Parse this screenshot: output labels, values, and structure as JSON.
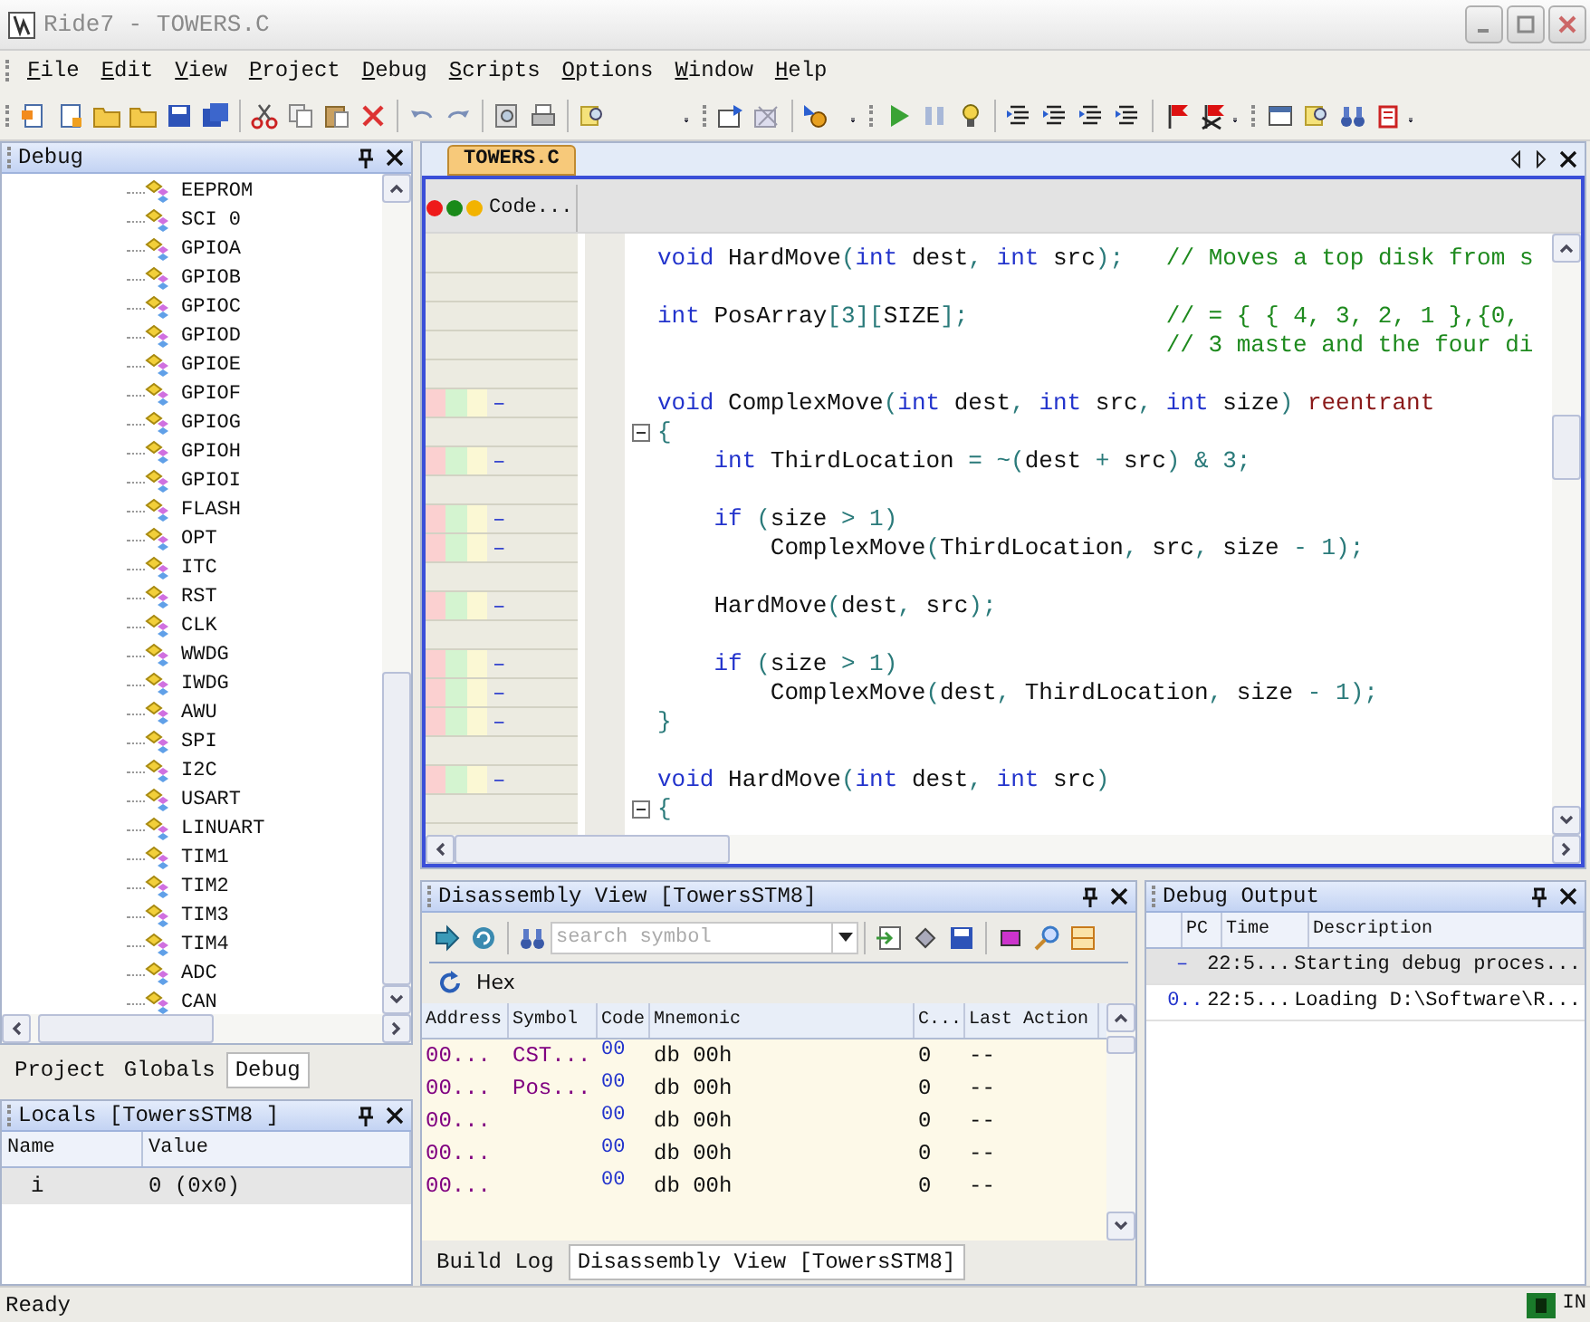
{
  "window": {
    "title": "Ride7 - TOWERS.C"
  },
  "menu": [
    "File",
    "Edit",
    "View",
    "Project",
    "Debug",
    "Scripts",
    "Options",
    "Window",
    "Help"
  ],
  "debug_panel": {
    "title": "Debug",
    "items": [
      "EEPROM",
      "SCI 0",
      "GPIOA",
      "GPIOB",
      "GPIOC",
      "GPIOD",
      "GPIOE",
      "GPIOF",
      "GPIOG",
      "GPIOH",
      "GPIOI",
      "FLASH",
      "OPT",
      "ITC",
      "RST",
      "CLK",
      "WWDG",
      "IWDG",
      "AWU",
      "SPI",
      "I2C",
      "USART",
      "LINUART",
      "TIM1",
      "TIM2",
      "TIM3",
      "TIM4",
      "ADC",
      "CAN"
    ]
  },
  "left_tabs": [
    {
      "label": "Project",
      "selected": false
    },
    {
      "label": "Globals",
      "selected": false
    },
    {
      "label": "Debug",
      "selected": true
    }
  ],
  "locals": {
    "title": "Locals [TowersSTM8 ]",
    "columns": [
      "Name",
      "Value"
    ],
    "rows": [
      [
        "i",
        "0 (0x0)"
      ]
    ]
  },
  "editor": {
    "tab": {
      "label": "TOWERS.C",
      "selected": true
    },
    "gutter_title": "Code...",
    "lines": [
      {
        "marked": false,
        "fold": false,
        "segments": [
          {
            "kind": "kw",
            "t": "void"
          },
          {
            "kind": "id",
            "t": " HardMove"
          },
          {
            "kind": "p",
            "t": "("
          },
          {
            "kind": "kw",
            "t": "int"
          },
          {
            "kind": "id",
            "t": " dest"
          },
          {
            "kind": "p",
            "t": ", "
          },
          {
            "kind": "kw",
            "t": "int"
          },
          {
            "kind": "id",
            "t": " src"
          },
          {
            "kind": "p",
            "t": ");"
          },
          {
            "kind": "c",
            "t": "   // Moves a top disk from s"
          }
        ]
      },
      {
        "marked": false,
        "fold": false
      },
      {
        "marked": false,
        "fold": false,
        "segments": [
          {
            "kind": "kw",
            "t": "int"
          },
          {
            "kind": "id",
            "t": " PosArray"
          },
          {
            "kind": "p",
            "t": "["
          },
          {
            "kind": "n",
            "t": "3"
          },
          {
            "kind": "p",
            "t": "]["
          },
          {
            "kind": "id",
            "t": "SIZE"
          },
          {
            "kind": "p",
            "t": "];"
          },
          {
            "kind": "c",
            "t": "              // = { { 4, 3, 2, 1 },{0,"
          }
        ]
      },
      {
        "marked": false,
        "fold": false,
        "segments": [
          {
            "kind": "c",
            "t": "                                    // 3 maste and the four di"
          }
        ]
      },
      {
        "marked": false,
        "fold": false
      },
      {
        "marked": true,
        "fold": false,
        "gutter": "–",
        "segments": [
          {
            "kind": "kw",
            "t": "void"
          },
          {
            "kind": "id",
            "t": " ComplexMove"
          },
          {
            "kind": "p",
            "t": "("
          },
          {
            "kind": "kw",
            "t": "int"
          },
          {
            "kind": "id",
            "t": " dest"
          },
          {
            "kind": "p",
            "t": ", "
          },
          {
            "kind": "kw",
            "t": "int"
          },
          {
            "kind": "id",
            "t": " src"
          },
          {
            "kind": "p",
            "t": ", "
          },
          {
            "kind": "kw",
            "t": "int"
          },
          {
            "kind": "id",
            "t": " size"
          },
          {
            "kind": "p",
            "t": ") "
          },
          {
            "kind": "r",
            "t": "reentrant"
          }
        ]
      },
      {
        "marked": false,
        "fold": true,
        "segments": [
          {
            "kind": "p",
            "t": "{"
          }
        ]
      },
      {
        "marked": true,
        "fold": false,
        "gutter": "–",
        "segments": [
          {
            "kind": "kw",
            "t": "    int"
          },
          {
            "kind": "id",
            "t": " ThirdLocation "
          },
          {
            "kind": "p",
            "t": "= ~("
          },
          {
            "kind": "id",
            "t": "dest "
          },
          {
            "kind": "p",
            "t": "+ "
          },
          {
            "kind": "id",
            "t": "src"
          },
          {
            "kind": "p",
            "t": ") & "
          },
          {
            "kind": "n",
            "t": "3"
          },
          {
            "kind": "p",
            "t": ";"
          }
        ]
      },
      {
        "marked": false,
        "fold": false
      },
      {
        "marked": true,
        "fold": false,
        "gutter": "–",
        "segments": [
          {
            "kind": "kw",
            "t": "    if"
          },
          {
            "kind": "p",
            "t": " ("
          },
          {
            "kind": "id",
            "t": "size "
          },
          {
            "kind": "p",
            "t": "> "
          },
          {
            "kind": "n",
            "t": "1"
          },
          {
            "kind": "p",
            "t": ")"
          }
        ]
      },
      {
        "marked": true,
        "fold": false,
        "gutter": "–",
        "segments": [
          {
            "kind": "id",
            "t": "        ComplexMove"
          },
          {
            "kind": "p",
            "t": "("
          },
          {
            "kind": "id",
            "t": "ThirdLocation"
          },
          {
            "kind": "p",
            "t": ", "
          },
          {
            "kind": "id",
            "t": "src"
          },
          {
            "kind": "p",
            "t": ", "
          },
          {
            "kind": "id",
            "t": "size "
          },
          {
            "kind": "p",
            "t": "- "
          },
          {
            "kind": "n",
            "t": "1"
          },
          {
            "kind": "p",
            "t": ");"
          }
        ]
      },
      {
        "marked": false,
        "fold": false
      },
      {
        "marked": true,
        "fold": false,
        "gutter": "–",
        "segments": [
          {
            "kind": "id",
            "t": "    HardMove"
          },
          {
            "kind": "p",
            "t": "("
          },
          {
            "kind": "id",
            "t": "dest"
          },
          {
            "kind": "p",
            "t": ", "
          },
          {
            "kind": "id",
            "t": "src"
          },
          {
            "kind": "p",
            "t": ");"
          }
        ]
      },
      {
        "marked": false,
        "fold": false
      },
      {
        "marked": true,
        "fold": false,
        "gutter": "–",
        "segments": [
          {
            "kind": "kw",
            "t": "    if"
          },
          {
            "kind": "p",
            "t": " ("
          },
          {
            "kind": "id",
            "t": "size "
          },
          {
            "kind": "p",
            "t": "> "
          },
          {
            "kind": "n",
            "t": "1"
          },
          {
            "kind": "p",
            "t": ")"
          }
        ]
      },
      {
        "marked": true,
        "fold": false,
        "gutter": "–",
        "segments": [
          {
            "kind": "id",
            "t": "        ComplexMove"
          },
          {
            "kind": "p",
            "t": "("
          },
          {
            "kind": "id",
            "t": "dest"
          },
          {
            "kind": "p",
            "t": ", "
          },
          {
            "kind": "id",
            "t": "ThirdLocation"
          },
          {
            "kind": "p",
            "t": ", "
          },
          {
            "kind": "id",
            "t": "size "
          },
          {
            "kind": "p",
            "t": "- "
          },
          {
            "kind": "n",
            "t": "1"
          },
          {
            "kind": "p",
            "t": ");"
          }
        ]
      },
      {
        "marked": true,
        "fold": false,
        "gutter": "–",
        "segments": [
          {
            "kind": "p",
            "t": "}"
          }
        ]
      },
      {
        "marked": false,
        "fold": false
      },
      {
        "marked": true,
        "fold": false,
        "gutter": "–",
        "segments": [
          {
            "kind": "kw",
            "t": "void"
          },
          {
            "kind": "id",
            "t": " HardMove"
          },
          {
            "kind": "p",
            "t": "("
          },
          {
            "kind": "kw",
            "t": "int"
          },
          {
            "kind": "id",
            "t": " dest"
          },
          {
            "kind": "p",
            "t": ", "
          },
          {
            "kind": "kw",
            "t": "int"
          },
          {
            "kind": "id",
            "t": " src"
          },
          {
            "kind": "p",
            "t": ")"
          }
        ]
      },
      {
        "marked": false,
        "fold": true,
        "segments": [
          {
            "kind": "p",
            "t": "{"
          }
        ]
      }
    ]
  },
  "disassembly": {
    "title": "Disassembly View [TowersSTM8]",
    "search": {
      "placeholder": "search symbol"
    },
    "hex_label": "Hex",
    "columns": [
      "Address",
      "Symbol",
      "Code",
      "Mnemonic",
      "C...",
      "Last Action"
    ],
    "rows": [
      [
        "00...",
        "CST...",
        "00",
        "db 00h",
        "0",
        "--"
      ],
      [
        "00...",
        "Pos...",
        "00",
        "db 00h",
        "0",
        "--"
      ],
      [
        "00...",
        "",
        "00",
        "db 00h",
        "0",
        "--"
      ],
      [
        "00...",
        "",
        "00",
        "db 00h",
        "0",
        "--"
      ],
      [
        "00...",
        "",
        "00",
        "db 00h",
        "0",
        "--"
      ]
    ]
  },
  "bottom_tabs": [
    {
      "label": "Build Log",
      "selected": false
    },
    {
      "label": "Disassembly View [TowersSTM8]",
      "selected": true
    }
  ],
  "debug_output": {
    "title": "Debug Output",
    "columns": [
      "PC",
      "Time",
      "Description"
    ],
    "rows": [
      {
        "pc": "–",
        "time": "22:5...",
        "description": "Starting debug proces...",
        "selected": true
      },
      {
        "pc": "0..",
        "time": "22:5...",
        "description": "Loading D:\\Software\\R...",
        "selected": false
      }
    ]
  },
  "status_bar": {
    "text": "Ready",
    "mode": "IN"
  }
}
